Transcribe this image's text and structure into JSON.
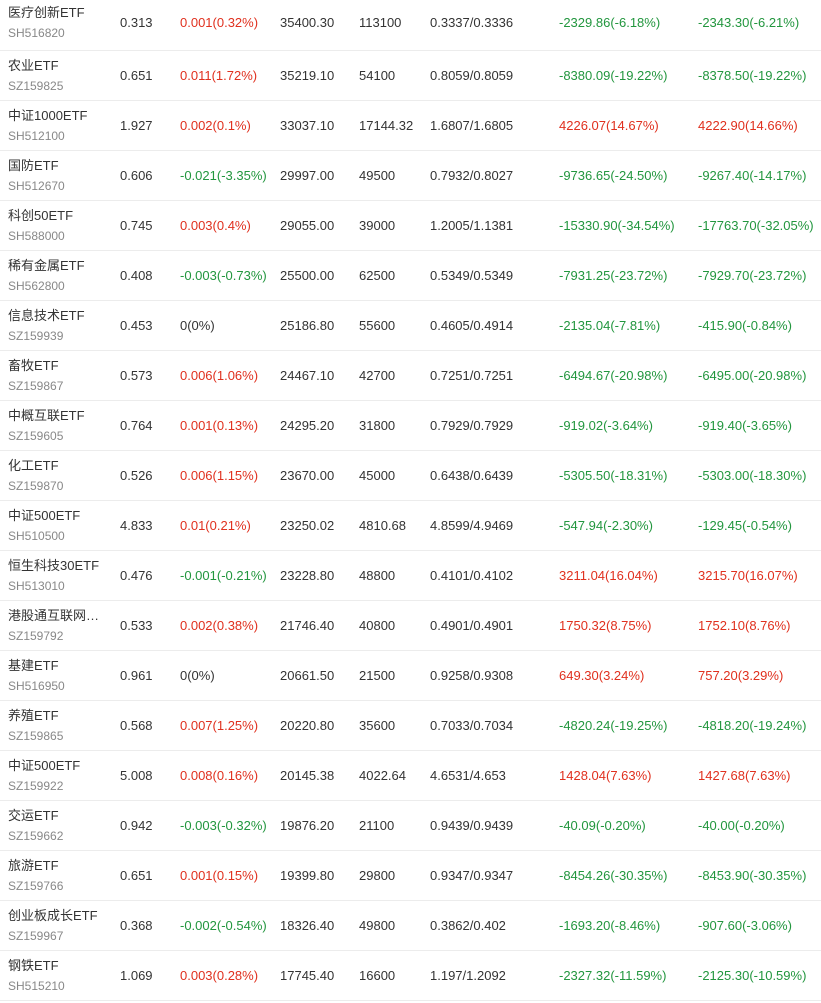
{
  "colors": {
    "up": "#e0301e",
    "down": "#22963e",
    "flat": "#333333"
  },
  "rows": [
    {
      "name": "医疗创新ETF",
      "code": "SH516820",
      "price": "0.313",
      "change": "0.001(0.32%)",
      "change_dir": "up",
      "amount": "35400.30",
      "volume": "113100",
      "nav": "0.3337/0.3336",
      "pl1": "-2329.86(-6.18%)",
      "pl1_dir": "down",
      "pl2": "-2343.30(-6.21%)",
      "pl2_dir": "down"
    },
    {
      "name": "农业ETF",
      "code": "SZ159825",
      "price": "0.651",
      "change": "0.011(1.72%)",
      "change_dir": "up",
      "amount": "35219.10",
      "volume": "54100",
      "nav": "0.8059/0.8059",
      "pl1": "-8380.09(-19.22%)",
      "pl1_dir": "down",
      "pl2": "-8378.50(-19.22%)",
      "pl2_dir": "down"
    },
    {
      "name": "中证1000ETF",
      "code": "SH512100",
      "price": "1.927",
      "change": "0.002(0.1%)",
      "change_dir": "up",
      "amount": "33037.10",
      "volume": "17144.32",
      "nav": "1.6807/1.6805",
      "pl1": "4226.07(14.67%)",
      "pl1_dir": "up",
      "pl2": "4222.90(14.66%)",
      "pl2_dir": "up"
    },
    {
      "name": "国防ETF",
      "code": "SH512670",
      "price": "0.606",
      "change": "-0.021(-3.35%)",
      "change_dir": "down",
      "amount": "29997.00",
      "volume": "49500",
      "nav": "0.7932/0.8027",
      "pl1": "-9736.65(-24.50%)",
      "pl1_dir": "down",
      "pl2": "-9267.40(-14.17%)",
      "pl2_dir": "down"
    },
    {
      "name": "科创50ETF",
      "code": "SH588000",
      "price": "0.745",
      "change": "0.003(0.4%)",
      "change_dir": "up",
      "amount": "29055.00",
      "volume": "39000",
      "nav": "1.2005/1.1381",
      "pl1": "-15330.90(-34.54%)",
      "pl1_dir": "down",
      "pl2": "-17763.70(-32.05%)",
      "pl2_dir": "down"
    },
    {
      "name": "稀有金属ETF",
      "code": "SH562800",
      "price": "0.408",
      "change": "-0.003(-0.73%)",
      "change_dir": "down",
      "amount": "25500.00",
      "volume": "62500",
      "nav": "0.5349/0.5349",
      "pl1": "-7931.25(-23.72%)",
      "pl1_dir": "down",
      "pl2": "-7929.70(-23.72%)",
      "pl2_dir": "down"
    },
    {
      "name": "信息技术ETF",
      "code": "SZ159939",
      "price": "0.453",
      "change": "0(0%)",
      "change_dir": "flat",
      "amount": "25186.80",
      "volume": "55600",
      "nav": "0.4605/0.4914",
      "pl1": "-2135.04(-7.81%)",
      "pl1_dir": "down",
      "pl2": "-415.90(-0.84%)",
      "pl2_dir": "down"
    },
    {
      "name": "畜牧ETF",
      "code": "SZ159867",
      "price": "0.573",
      "change": "0.006(1.06%)",
      "change_dir": "up",
      "amount": "24467.10",
      "volume": "42700",
      "nav": "0.7251/0.7251",
      "pl1": "-6494.67(-20.98%)",
      "pl1_dir": "down",
      "pl2": "-6495.00(-20.98%)",
      "pl2_dir": "down"
    },
    {
      "name": "中概互联ETF",
      "code": "SZ159605",
      "price": "0.764",
      "change": "0.001(0.13%)",
      "change_dir": "up",
      "amount": "24295.20",
      "volume": "31800",
      "nav": "0.7929/0.7929",
      "pl1": "-919.02(-3.64%)",
      "pl1_dir": "down",
      "pl2": "-919.40(-3.65%)",
      "pl2_dir": "down"
    },
    {
      "name": "化工ETF",
      "code": "SZ159870",
      "price": "0.526",
      "change": "0.006(1.15%)",
      "change_dir": "up",
      "amount": "23670.00",
      "volume": "45000",
      "nav": "0.6438/0.6439",
      "pl1": "-5305.50(-18.31%)",
      "pl1_dir": "down",
      "pl2": "-5303.00(-18.30%)",
      "pl2_dir": "down"
    },
    {
      "name": "中证500ETF",
      "code": "SH510500",
      "price": "4.833",
      "change": "0.01(0.21%)",
      "change_dir": "up",
      "amount": "23250.02",
      "volume": "4810.68",
      "nav": "4.8599/4.9469",
      "pl1": "-547.94(-2.30%)",
      "pl1_dir": "down",
      "pl2": "-129.45(-0.54%)",
      "pl2_dir": "down"
    },
    {
      "name": "恒生科技30ETF",
      "code": "SH513010",
      "price": "0.476",
      "change": "-0.001(-0.21%)",
      "change_dir": "down",
      "amount": "23228.80",
      "volume": "48800",
      "nav": "0.4101/0.4102",
      "pl1": "3211.04(16.04%)",
      "pl1_dir": "up",
      "pl2": "3215.70(16.07%)",
      "pl2_dir": "up"
    },
    {
      "name": "港股通互联网ETF",
      "code": "SZ159792",
      "price": "0.533",
      "change": "0.002(0.38%)",
      "change_dir": "up",
      "amount": "21746.40",
      "volume": "40800",
      "nav": "0.4901/0.4901",
      "pl1": "1750.32(8.75%)",
      "pl1_dir": "up",
      "pl2": "1752.10(8.76%)",
      "pl2_dir": "up"
    },
    {
      "name": "基建ETF",
      "code": "SH516950",
      "price": "0.961",
      "change": "0(0%)",
      "change_dir": "flat",
      "amount": "20661.50",
      "volume": "21500",
      "nav": "0.9258/0.9308",
      "pl1": "649.30(3.24%)",
      "pl1_dir": "up",
      "pl2": "757.20(3.29%)",
      "pl2_dir": "up"
    },
    {
      "name": "养殖ETF",
      "code": "SZ159865",
      "price": "0.568",
      "change": "0.007(1.25%)",
      "change_dir": "up",
      "amount": "20220.80",
      "volume": "35600",
      "nav": "0.7033/0.7034",
      "pl1": "-4820.24(-19.25%)",
      "pl1_dir": "down",
      "pl2": "-4818.20(-19.24%)",
      "pl2_dir": "down"
    },
    {
      "name": "中证500ETF",
      "code": "SZ159922",
      "price": "5.008",
      "change": "0.008(0.16%)",
      "change_dir": "up",
      "amount": "20145.38",
      "volume": "4022.64",
      "nav": "4.6531/4.653",
      "pl1": "1428.04(7.63%)",
      "pl1_dir": "up",
      "pl2": "1427.68(7.63%)",
      "pl2_dir": "up"
    },
    {
      "name": "交运ETF",
      "code": "SZ159662",
      "price": "0.942",
      "change": "-0.003(-0.32%)",
      "change_dir": "down",
      "amount": "19876.20",
      "volume": "21100",
      "nav": "0.9439/0.9439",
      "pl1": "-40.09(-0.20%)",
      "pl1_dir": "down",
      "pl2": "-40.00(-0.20%)",
      "pl2_dir": "down"
    },
    {
      "name": "旅游ETF",
      "code": "SZ159766",
      "price": "0.651",
      "change": "0.001(0.15%)",
      "change_dir": "up",
      "amount": "19399.80",
      "volume": "29800",
      "nav": "0.9347/0.9347",
      "pl1": "-8454.26(-30.35%)",
      "pl1_dir": "down",
      "pl2": "-8453.90(-30.35%)",
      "pl2_dir": "down"
    },
    {
      "name": "创业板成长ETF",
      "code": "SZ159967",
      "price": "0.368",
      "change": "-0.002(-0.54%)",
      "change_dir": "down",
      "amount": "18326.40",
      "volume": "49800",
      "nav": "0.3862/0.402",
      "pl1": "-1693.20(-8.46%)",
      "pl1_dir": "down",
      "pl2": "-907.60(-3.06%)",
      "pl2_dir": "down"
    },
    {
      "name": "钢铁ETF",
      "code": "SH515210",
      "price": "1.069",
      "change": "0.003(0.28%)",
      "change_dir": "up",
      "amount": "17745.40",
      "volume": "16600",
      "nav": "1.197/1.2092",
      "pl1": "-2327.32(-11.59%)",
      "pl1_dir": "down",
      "pl2": "-2125.30(-10.59%)",
      "pl2_dir": "down"
    }
  ]
}
